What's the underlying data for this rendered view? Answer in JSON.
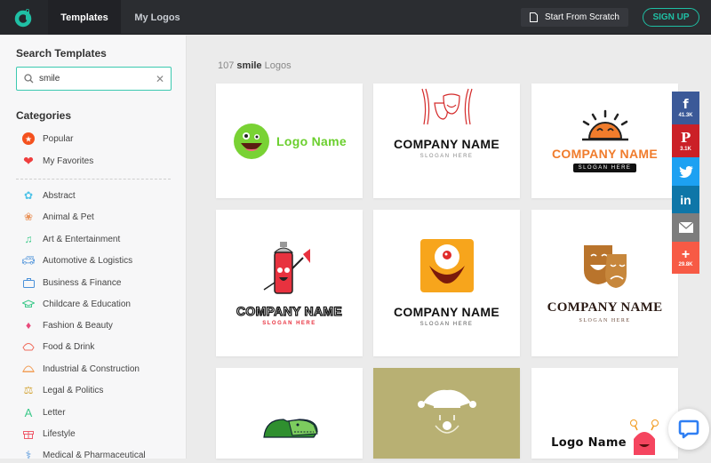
{
  "header": {
    "tabs": [
      {
        "label": "Templates",
        "active": true
      },
      {
        "label": "My Logos",
        "active": false
      }
    ],
    "start_from_scratch": "Start From Scratch",
    "sign_up": "SIGN UP",
    "brand_color": "#1fbfa4"
  },
  "sidebar": {
    "search_title": "Search Templates",
    "search_value": "smile",
    "categories_title": "Categories",
    "pinned": [
      {
        "label": "Popular",
        "icon": "star-badge-icon"
      },
      {
        "label": "My Favorites",
        "icon": "heart-icon"
      }
    ],
    "categories": [
      {
        "label": "Abstract",
        "icon": "abstract-icon"
      },
      {
        "label": "Animal & Pet",
        "icon": "paw-icon"
      },
      {
        "label": "Art & Entertainment",
        "icon": "music-note-icon"
      },
      {
        "label": "Automotive & Logistics",
        "icon": "car-icon"
      },
      {
        "label": "Business & Finance",
        "icon": "briefcase-icon"
      },
      {
        "label": "Childcare & Education",
        "icon": "graduation-cap-icon"
      },
      {
        "label": "Fashion & Beauty",
        "icon": "diamond-icon"
      },
      {
        "label": "Food & Drink",
        "icon": "food-icon"
      },
      {
        "label": "Industrial & Construction",
        "icon": "helmet-icon"
      },
      {
        "label": "Legal & Politics",
        "icon": "scales-icon"
      },
      {
        "label": "Letter",
        "icon": "letter-a-icon"
      },
      {
        "label": "Lifestyle",
        "icon": "gift-icon"
      },
      {
        "label": "Medical & Pharmaceutical",
        "icon": "stethoscope-icon"
      }
    ]
  },
  "results": {
    "count": "107",
    "query": "smile",
    "suffix": "Logos",
    "cards": [
      {
        "name": "Logo Name",
        "slogan": ""
      },
      {
        "name": "COMPANY NAME",
        "slogan": "SLOGAN HERE"
      },
      {
        "name": "COMPANY NAME",
        "slogan": "SLOGAN HERE"
      },
      {
        "name": "COMPANY NAME",
        "slogan": "SLOGAN HERE"
      },
      {
        "name": "COMPANY NAME",
        "slogan": "SLOGAN HERE"
      },
      {
        "name": "COMPANY NAME",
        "slogan": "SLOGAN HERE"
      },
      {
        "name": "",
        "slogan": ""
      },
      {
        "name": "",
        "slogan": ""
      },
      {
        "name": "Logo Name",
        "slogan": ""
      }
    ]
  },
  "social": [
    {
      "network": "facebook",
      "count": "41.3K",
      "color": "#3b5998"
    },
    {
      "network": "pinterest",
      "count": "3.1K",
      "color": "#cb2027"
    },
    {
      "network": "twitter",
      "count": "",
      "color": "#1da1f2"
    },
    {
      "network": "linkedin",
      "count": "",
      "color": "#0e76a8"
    },
    {
      "network": "email",
      "count": "",
      "color": "#7d7d7d"
    },
    {
      "network": "more",
      "count": "29.8K",
      "color": "#f75a45"
    }
  ]
}
